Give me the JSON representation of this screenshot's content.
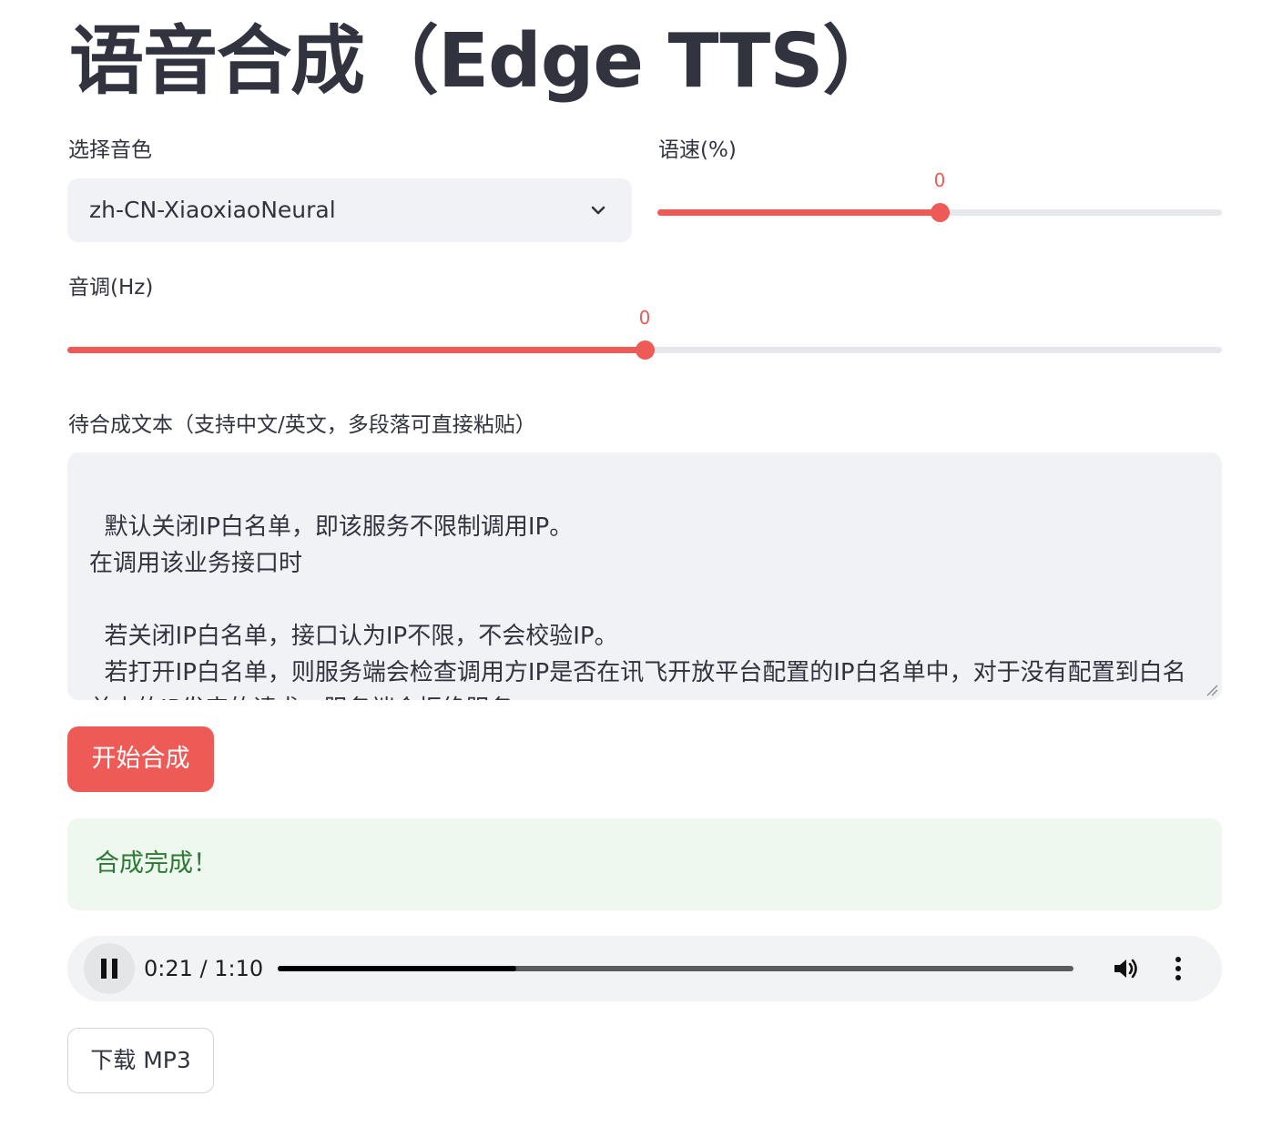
{
  "page": {
    "title": "语音合成（Edge TTS）"
  },
  "voice_select": {
    "label": "选择音色",
    "value": "zh-CN-XiaoxiaoNeural"
  },
  "rate_slider": {
    "label": "语速(%)",
    "value": "0",
    "fraction": 0.5
  },
  "pitch_slider": {
    "label": "音调(Hz)",
    "value": "0",
    "fraction": 0.5
  },
  "text_input": {
    "label": "待合成文本（支持中文/英文，多段落可直接粘贴）",
    "value": "默认关闭IP白名单，即该服务不限制调用IP。\n在调用该业务接口时\n\n  若关闭IP白名单，接口认为IP不限，不会校验IP。\n  若打开IP白名单，则服务端会检查调用方IP是否在讯飞开放平台配置的IP白名单中，对于没有配置到白名单中的IP发来的请求，服务端会拒绝服务。"
  },
  "synthesize_button": {
    "label": "开始合成",
    "color": "#ee5a56"
  },
  "success_alert": {
    "text": "合成完成！"
  },
  "audio_player": {
    "current_time": "0:21",
    "duration": "1:10",
    "time_text": "0:21 / 1:10",
    "progress_fraction": 0.3,
    "state": "playing",
    "play_icon": "pause-icon",
    "volume_icon": "volume-icon",
    "menu_icon": "more-vert-icon"
  },
  "download_button": {
    "label": "下载 MP3"
  }
}
